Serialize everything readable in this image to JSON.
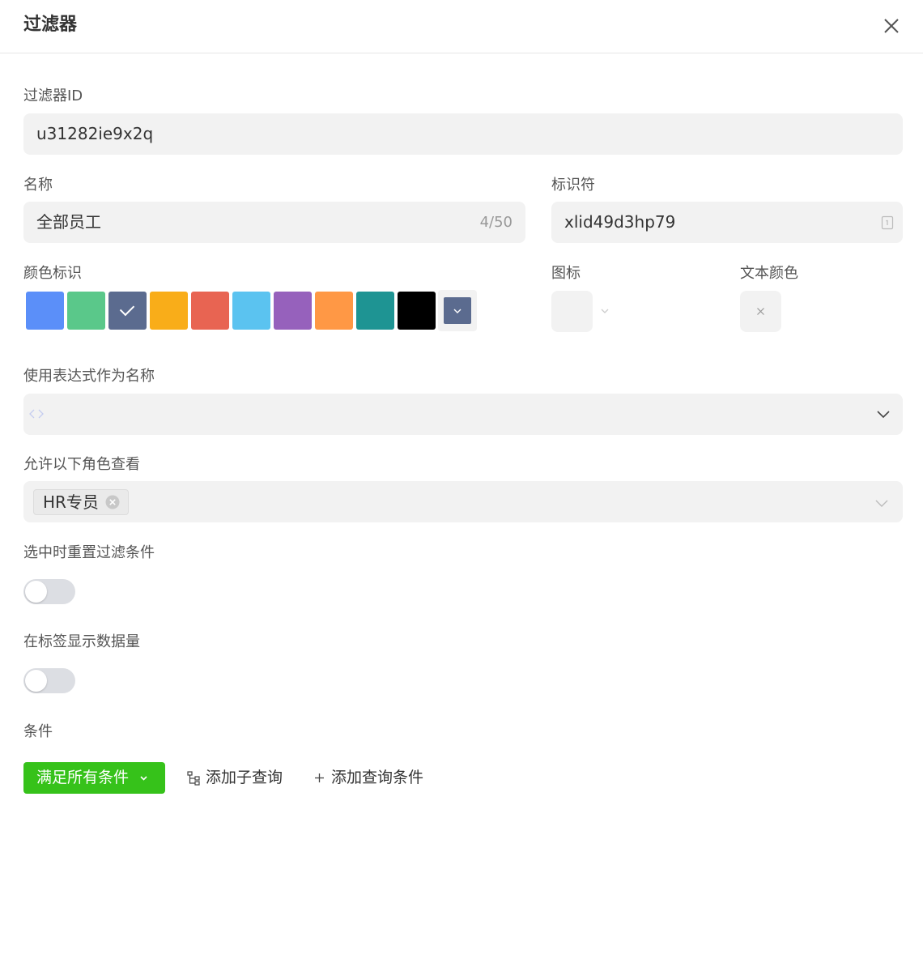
{
  "header": {
    "title": "过滤器"
  },
  "filter_id": {
    "label": "过滤器ID",
    "value": "u31282ie9x2q"
  },
  "name": {
    "label": "名称",
    "value": "全部员工",
    "counter": "4/50"
  },
  "identifier": {
    "label": "标识符",
    "value": "xlid49d3hp79"
  },
  "color_tag": {
    "label": "颜色标识",
    "swatches": [
      "#5b8ff9",
      "#5ac88a",
      "#5b6b8f",
      "#f9ad19",
      "#e86452",
      "#5bc3f0",
      "#9661bc",
      "#ff9845",
      "#1e9493",
      "#000000"
    ],
    "selected_index": 2,
    "custom_color": "#5b6b8f"
  },
  "icon": {
    "label": "图标"
  },
  "text_color": {
    "label": "文本颜色"
  },
  "expression_name": {
    "label": "使用表达式作为名称"
  },
  "roles": {
    "label": "允许以下角色查看",
    "tags": [
      "HR专员"
    ]
  },
  "reset_on_select": {
    "label": "选中时重置过滤条件",
    "enabled": false
  },
  "show_count": {
    "label": "在标签显示数据量",
    "enabled": false
  },
  "conditions": {
    "label": "条件",
    "match_button": "满足所有条件",
    "add_subquery": "添加子查询",
    "add_condition": "添加查询条件"
  },
  "colors": {
    "accent_green": "#36c21a",
    "field_bg": "#f2f2f2"
  }
}
